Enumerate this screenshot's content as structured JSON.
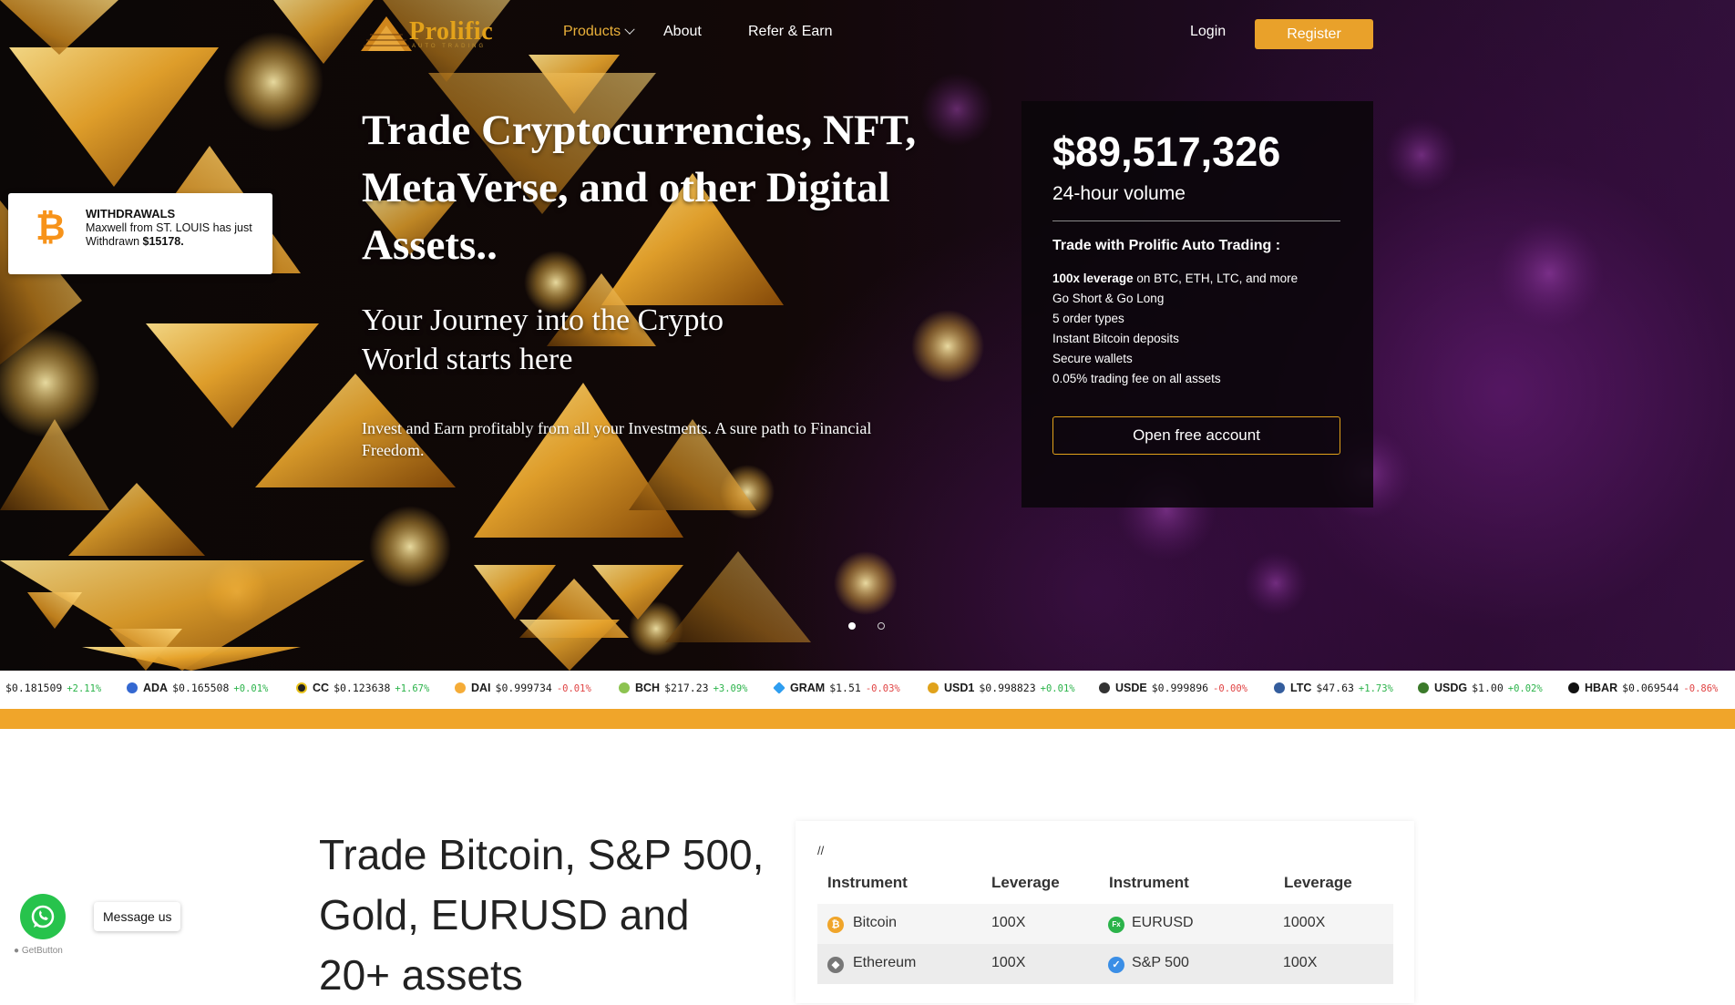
{
  "nav": {
    "logo_text": "Prolific",
    "logo_sub": "AUTO TRADING",
    "products": "Products",
    "about": "About",
    "refer": "Refer & Earn",
    "login": "Login",
    "register": "Register"
  },
  "hero": {
    "headline": "Trade Cryptocurrencies, NFT, MetaVerse, and other Digital Assets..",
    "subhead": "Your Journey into the Crypto World starts here",
    "desc": "Invest and Earn profitably from all your Investments. A sure path to Financial Freedom."
  },
  "volume_card": {
    "amount": "$89,517,326",
    "label": "24-hour volume",
    "title": "Trade with Prolific Auto Trading :",
    "features": [
      {
        "bold": "100x leverage",
        "text": " on BTC, ETH, LTC, and more"
      },
      {
        "bold": "",
        "text": "Go Short & Go Long"
      },
      {
        "bold": "",
        "text": "5 order types"
      },
      {
        "bold": "",
        "text": "Instant Bitcoin deposits"
      },
      {
        "bold": "",
        "text": "Secure wallets"
      },
      {
        "bold": "",
        "text": "0.05% trading fee on all assets"
      }
    ],
    "button": "Open free account"
  },
  "withdrawal": {
    "title": "WITHDRAWALS",
    "text": "Maxwell from ST. LOUIS has just Withdrawn",
    "amount": "$15178."
  },
  "ticker": [
    {
      "sym": "",
      "price": "$0.181509",
      "change": "+2.11%",
      "dir": "up",
      "color": "#ffffff"
    },
    {
      "sym": "ADA",
      "price": "$0.165508",
      "change": "+0.01%",
      "dir": "up",
      "color": "#3468d1"
    },
    {
      "sym": "CC",
      "price": "$0.123638",
      "change": "+1.67%",
      "dir": "up",
      "color": "#222222"
    },
    {
      "sym": "DAI",
      "price": "$0.999734",
      "change": "-0.01%",
      "dir": "down",
      "color": "#f5ac37"
    },
    {
      "sym": "BCH",
      "price": "$217.23",
      "change": "+3.09%",
      "dir": "up",
      "color": "#8dc351"
    },
    {
      "sym": "GRAM",
      "price": "$1.51",
      "change": "-0.03%",
      "dir": "down",
      "color": "#2f9ef0"
    },
    {
      "sym": "USD1",
      "price": "$0.998823",
      "change": "+0.01%",
      "dir": "up",
      "color": "#e0a21b"
    },
    {
      "sym": "USDE",
      "price": "$0.999896",
      "change": "-0.00%",
      "dir": "down",
      "color": "#333333"
    },
    {
      "sym": "LTC",
      "price": "$47.63",
      "change": "+1.73%",
      "dir": "up",
      "color": "#345d9d"
    },
    {
      "sym": "USDG",
      "price": "$1.00",
      "change": "+0.02%",
      "dir": "up",
      "color": "#3b7a2a"
    },
    {
      "sym": "HBAR",
      "price": "$0.069544",
      "change": "-0.86%",
      "dir": "down",
      "color": "#111111"
    }
  ],
  "section": {
    "heading": "Trade Bitcoin, S&P 500, Gold, EURUSD and 20+ assets",
    "slash": "//",
    "headers": [
      "Instrument",
      "Leverage",
      "Instrument",
      "Leverage"
    ],
    "rows": [
      {
        "a": "Bitcoin",
        "al": "100X",
        "b": "EURUSD",
        "bl": "1000X"
      },
      {
        "a": "Ethereum",
        "al": "100X",
        "b": "S&P 500",
        "bl": "100X"
      }
    ]
  },
  "chat": {
    "label": "Message us",
    "powered": "GetButton"
  },
  "colors": {
    "accent": "#e9a12a",
    "ticker_up": "#2bb34a",
    "ticker_down": "#e04343",
    "whatsapp": "#27c34c"
  }
}
